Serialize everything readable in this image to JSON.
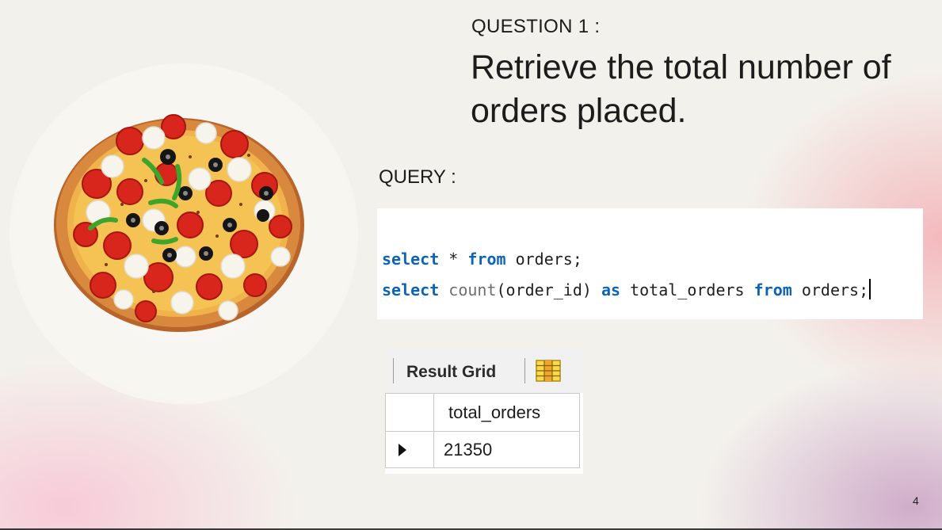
{
  "question": {
    "label": "QUESTION 1 :",
    "text": "Retrieve the total number of orders placed."
  },
  "query": {
    "label": "QUERY :",
    "lines": [
      [
        {
          "t": "select",
          "c": "kw"
        },
        {
          "t": " * ",
          "c": ""
        },
        {
          "t": "from",
          "c": "kw"
        },
        {
          "t": " orders;",
          "c": ""
        }
      ],
      [
        {
          "t": "select",
          "c": "kw"
        },
        {
          "t": " ",
          "c": ""
        },
        {
          "t": "count",
          "c": "fn"
        },
        {
          "t": "(order_id) ",
          "c": ""
        },
        {
          "t": "as",
          "c": "kw"
        },
        {
          "t": " total_orders ",
          "c": ""
        },
        {
          "t": "from",
          "c": "kw"
        },
        {
          "t": " orders;",
          "c": ""
        }
      ]
    ]
  },
  "result": {
    "toolbar_label": "Result Grid",
    "toolbar_icon": "grid-view-icon",
    "column": "total_orders",
    "value": "21350"
  },
  "colors": {
    "keyword": "#0f63b4",
    "function": "#6e6e6e"
  },
  "page_number": "4"
}
